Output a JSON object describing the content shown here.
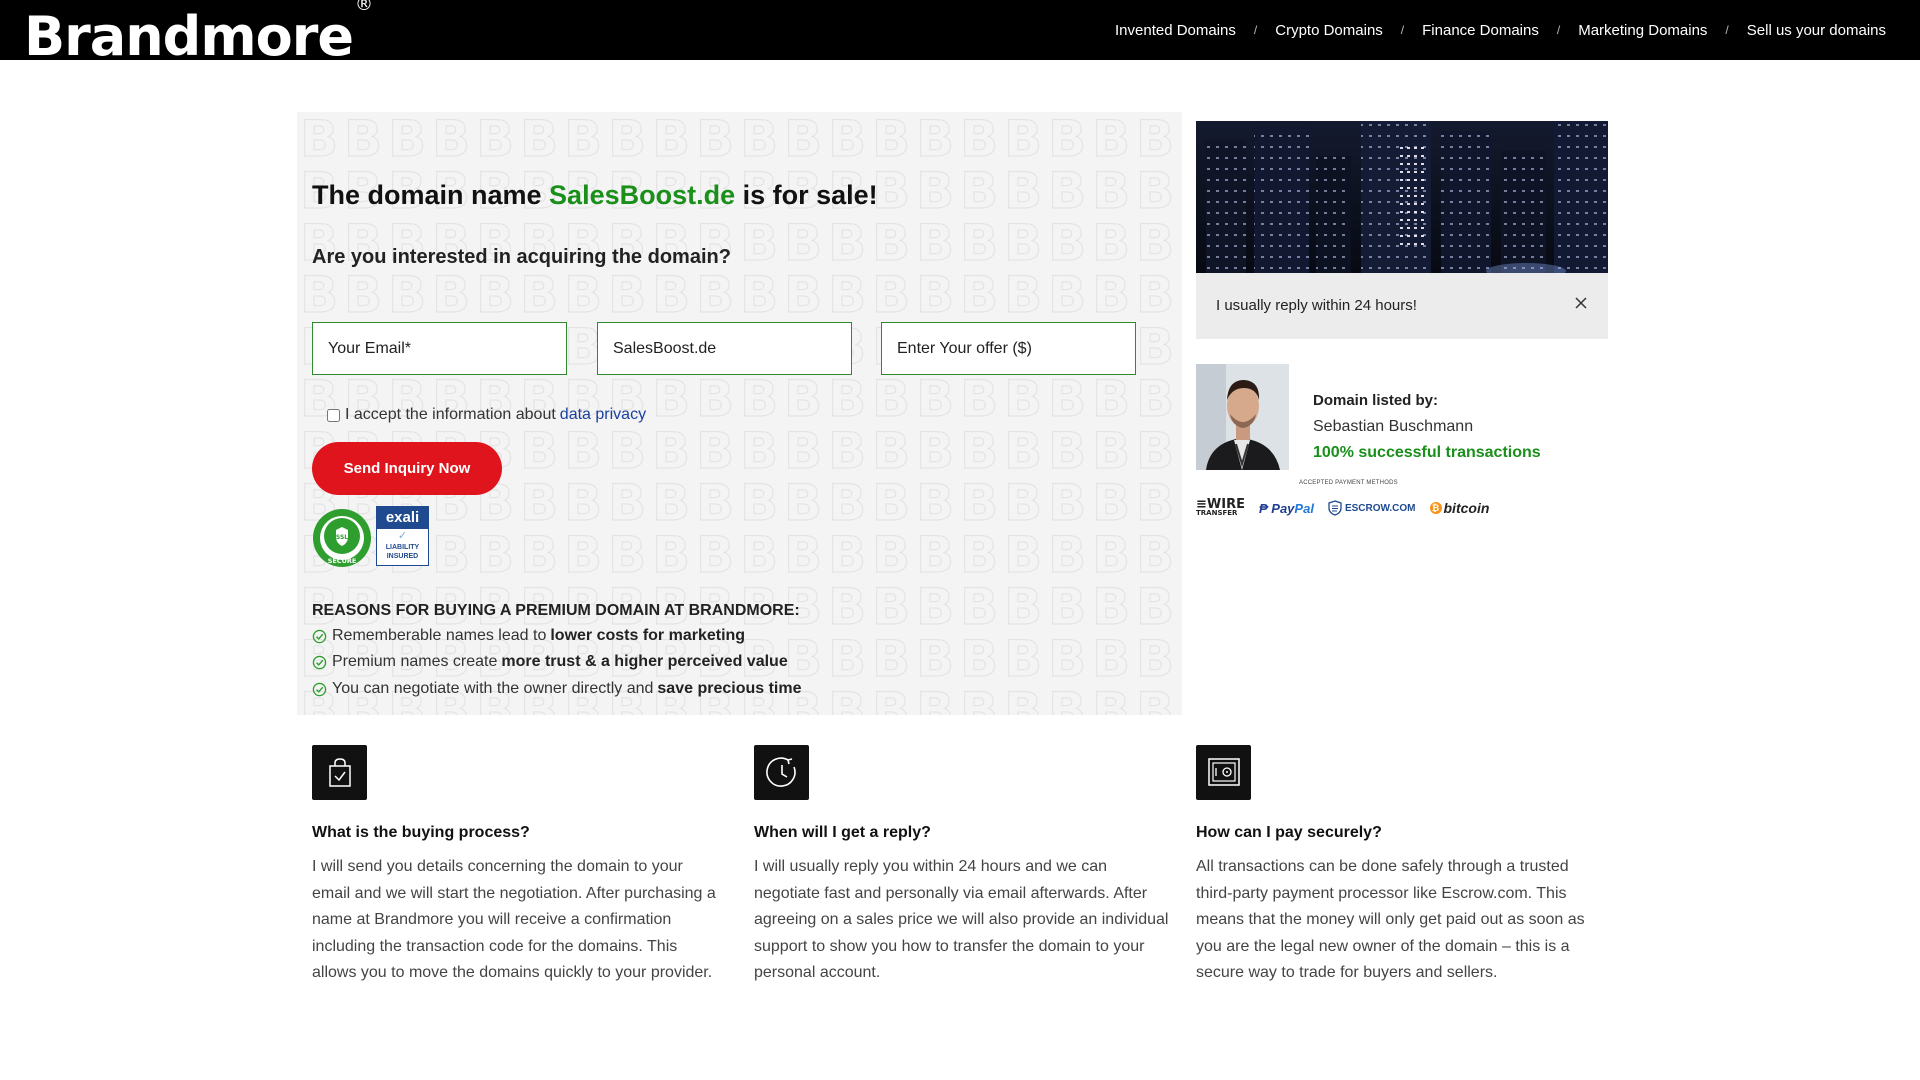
{
  "header": {
    "logo": "Brandmore",
    "logo_mark": "®",
    "nav": [
      "Invented Domains",
      "Crypto Domains",
      "Finance Domains",
      "Marketing Domains",
      "Sell us your domains"
    ],
    "separator": "/"
  },
  "hero": {
    "title_prefix": "The domain name ",
    "domain": "SalesBoost.de",
    "title_suffix": " is for sale!",
    "subtitle": "Are you interested in acquiring the domain?"
  },
  "form": {
    "email_placeholder": "Your Email*",
    "domain_value": "SalesBoost.de",
    "offer_placeholder": "Enter Your offer ($)",
    "privacy_text": "I accept the information about",
    "privacy_link": "data privacy",
    "submit_label": "Send Inquiry Now"
  },
  "badges": {
    "ssl_label": "SSL",
    "ssl_secure": "SECURE",
    "exali_name": "exali",
    "exali_line1": "LIABILITY",
    "exali_line2": "INSURED"
  },
  "reasons": {
    "heading": "REASONS FOR BUYING A PREMIUM DOMAIN AT BRANDMORE:",
    "items": [
      {
        "text": "Rememberable names lead to",
        "bold": "lower costs for marketing"
      },
      {
        "text": "Premium names create",
        "bold": "more trust & a higher perceived value"
      },
      {
        "text": "You can negotiate with the owner directly and",
        "bold": "save precious time"
      }
    ]
  },
  "reply": {
    "text": "I usually reply within 24 hours!"
  },
  "seller": {
    "label": "Domain listed by:",
    "name": "Sebastian Buschmann",
    "stat": "100% successful transactions"
  },
  "payment": {
    "label": "ACCEPTED PAYMENT METHODS",
    "wire": "WIRE",
    "wire_sub": "TRANSFER",
    "paypal_a": "Pay",
    "paypal_b": "Pal",
    "escrow": "ESCROW.COM",
    "bitcoin": "bitcoin"
  },
  "info": [
    {
      "icon": "shopping-bag-icon",
      "title": "What is the buying process?",
      "text": "I will send you details concerning the domain to your email and we will start the negotiation. After purchasing a name at Brandmore you will receive a confirmation including the transaction code for the domains. This allows you to move the domains quickly to your provider."
    },
    {
      "icon": "clock-icon",
      "title": "When will I get a reply?",
      "text": "I will usually reply you within 24 hours and we can negotiate fast and personally via email afterwards. After agreeing on a sales price we will also provide an individual support to show you how to transfer the domain to your personal account."
    },
    {
      "icon": "safe-icon",
      "title": "How can I pay securely?",
      "text": "All transactions can be done safely through a trusted third-party payment processor like Escrow.com. This means that the money will only get paid out as soon as you are the legal new owner of the domain – this is a secure way to trade for buyers and sellers."
    }
  ],
  "colors": {
    "accent_green": "#1a8f1a",
    "button_red": "#e0141c",
    "header_bg": "#000000"
  }
}
